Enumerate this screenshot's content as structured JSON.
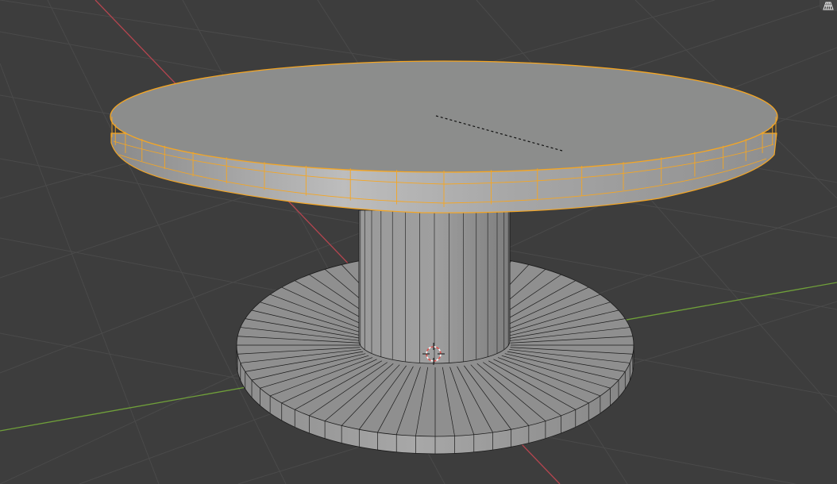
{
  "app": {
    "name": ""
  },
  "viewport": {
    "mode": "edit-mode",
    "shading": "solid",
    "grid_visible": true,
    "selection": "table-top-ring",
    "icons": {
      "perspective_toggle": "grid-perspective-icon",
      "cursor": "3d-cursor-icon"
    }
  },
  "colors": {
    "background": "#3d3d3d",
    "grid_line": "#4a4a4a",
    "axis_x": "#b5454f",
    "axis_y": "#70a03a",
    "selection": "#f5a623",
    "mesh_fill": "#8c8d8c",
    "mesh_side_light": "#bdbdbd",
    "mesh_edge": "#1a1a1a"
  }
}
